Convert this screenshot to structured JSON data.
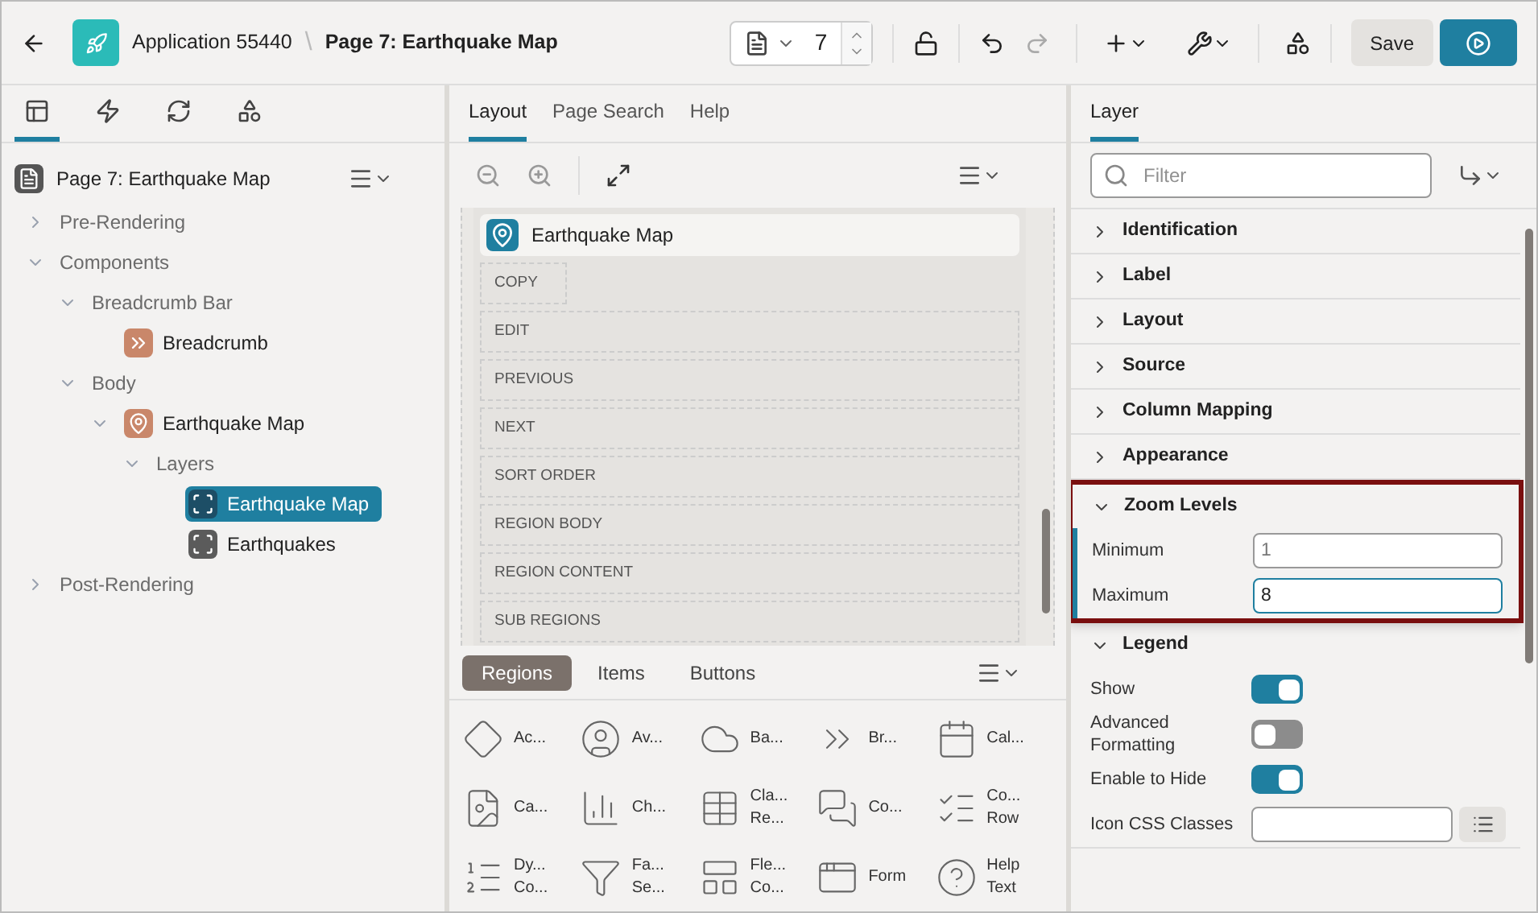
{
  "header": {
    "app": "Application 55440",
    "separator": "\\",
    "page": "Page 7: Earthquake Map",
    "page_number": "7",
    "save": "Save"
  },
  "left_tabs": [
    {
      "selected": true
    },
    {
      "selected": false
    },
    {
      "selected": false
    },
    {
      "selected": false
    }
  ],
  "tree": {
    "title": "Page 7: Earthquake Map",
    "items": [
      {
        "label": "Pre-Rendering",
        "kind": "group",
        "expanded": false,
        "selected": false
      },
      {
        "label": "Components",
        "kind": "group",
        "expanded": true,
        "selected": false,
        "children": [
          {
            "label": "Breadcrumb Bar",
            "kind": "group",
            "expanded": true,
            "selected": false,
            "children": [
              {
                "label": "Breadcrumb",
                "kind": "breadcrumb",
                "selected": false
              }
            ]
          },
          {
            "label": "Body",
            "kind": "group",
            "expanded": true,
            "selected": false,
            "children": [
              {
                "label": "Earthquake Map",
                "kind": "map",
                "expanded": true,
                "selected": false,
                "children": [
                  {
                    "label": "Layers",
                    "kind": "group",
                    "expanded": true,
                    "selected": false,
                    "children": [
                      {
                        "label": "Earthquake Map",
                        "kind": "layer",
                        "selected": true
                      },
                      {
                        "label": "Earthquakes",
                        "kind": "layer",
                        "selected": false
                      }
                    ]
                  }
                ]
              }
            ]
          }
        ]
      },
      {
        "label": "Post-Rendering",
        "kind": "group",
        "expanded": false,
        "selected": false
      }
    ]
  },
  "center_tabs": [
    {
      "label": "Layout",
      "selected": true
    },
    {
      "label": "Page Search",
      "selected": false
    },
    {
      "label": "Help",
      "selected": false
    }
  ],
  "layout": {
    "region": "Earthquake Map",
    "slots": [
      "COPY",
      "EDIT",
      "PREVIOUS",
      "NEXT",
      "SORT ORDER",
      "REGION BODY",
      "REGION CONTENT",
      "SUB REGIONS"
    ]
  },
  "gallery_tabs": [
    {
      "label": "Regions",
      "selected": true
    },
    {
      "label": "Items",
      "selected": false
    },
    {
      "label": "Buttons",
      "selected": false
    }
  ],
  "gallery": [
    {
      "lines": [
        "Ac..."
      ]
    },
    {
      "lines": [
        "Av..."
      ]
    },
    {
      "lines": [
        "Ba..."
      ]
    },
    {
      "lines": [
        "Br..."
      ]
    },
    {
      "lines": [
        "Cal..."
      ]
    },
    {
      "lines": [
        "Ca..."
      ]
    },
    {
      "lines": [
        "Ch..."
      ]
    },
    {
      "lines": [
        "Cla...",
        "Re..."
      ]
    },
    {
      "lines": [
        "Co..."
      ]
    },
    {
      "lines": [
        "Co...",
        "Row"
      ]
    },
    {
      "lines": [
        "Dy...",
        "Co..."
      ]
    },
    {
      "lines": [
        "Fa...",
        "Se..."
      ]
    },
    {
      "lines": [
        "Fle...",
        "Co..."
      ]
    },
    {
      "lines": [
        "Form"
      ]
    },
    {
      "lines": [
        "Help",
        "Text"
      ]
    }
  ],
  "right_tab": {
    "label": "Layer",
    "selected": true
  },
  "filter": {
    "placeholder": "Filter"
  },
  "sections": [
    {
      "title": "Identification",
      "expanded": false,
      "highlighted": false
    },
    {
      "title": "Label",
      "expanded": false,
      "highlighted": false
    },
    {
      "title": "Layout",
      "expanded": false,
      "highlighted": false
    },
    {
      "title": "Source",
      "expanded": false,
      "highlighted": false
    },
    {
      "title": "Column Mapping",
      "expanded": false,
      "highlighted": false
    },
    {
      "title": "Appearance",
      "expanded": false,
      "highlighted": false
    },
    {
      "title": "Zoom Levels",
      "expanded": true,
      "highlighted": true,
      "rows": [
        {
          "kind": "field",
          "label": "Minimum",
          "value": "1",
          "focused": false
        },
        {
          "kind": "field",
          "label": "Maximum",
          "value": "8",
          "focused": true
        }
      ]
    },
    {
      "title": "Legend",
      "expanded": true,
      "highlighted": false,
      "rows": [
        {
          "kind": "toggle",
          "label": "Show",
          "on": true
        },
        {
          "kind": "toggle",
          "label": "Advanced Formatting",
          "on": false
        },
        {
          "kind": "toggle",
          "label": "Enable to Hide",
          "on": true
        },
        {
          "kind": "picker",
          "label": "Icon CSS Classes"
        }
      ]
    }
  ]
}
